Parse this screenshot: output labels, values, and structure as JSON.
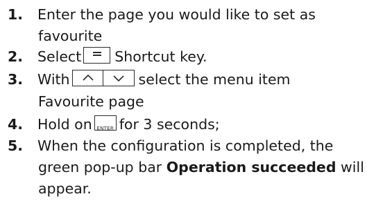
{
  "steps": [
    {
      "number": "1.",
      "line1": "Enter the page you would like to set as",
      "line2": "favourite"
    },
    {
      "number": "2.",
      "before": "Select",
      "key_icon": "menu-key-icon",
      "after": "Shortcut key."
    },
    {
      "number": "3.",
      "before": "With",
      "key_icons": [
        "up-arrow-key-icon",
        "down-arrow-key-icon"
      ],
      "after": "select the menu item",
      "line2": "Favourite page"
    },
    {
      "number": "4.",
      "before": "Hold on",
      "key_label": "ENTER",
      "after": "for 3 seconds;"
    },
    {
      "number": "5.",
      "line1": "When the configuration is completed, the",
      "line2_before": "green pop-up bar",
      "line2_bold": "Operation succeeded",
      "line2_after": "will",
      "line3": "appear."
    }
  ]
}
